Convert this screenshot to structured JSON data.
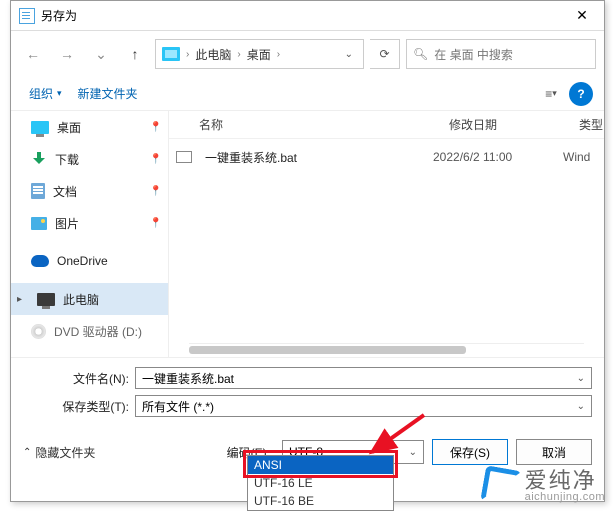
{
  "title": "另存为",
  "nav": {
    "back": "←",
    "fwd": "→",
    "up": "↑",
    "refresh": "⟳"
  },
  "address": {
    "crumb1": "此电脑",
    "crumb2": "桌面",
    "sep": "›",
    "dd": "⌄"
  },
  "search": {
    "placeholder": "在 桌面 中搜索",
    "icon": "🔍"
  },
  "toolbar": {
    "organize": "组织",
    "newfolder": "新建文件夹",
    "view": "≡",
    "help": "?"
  },
  "sidebar": {
    "items": [
      {
        "label": "桌面"
      },
      {
        "label": "下载"
      },
      {
        "label": "文档"
      },
      {
        "label": "图片"
      },
      {
        "label": "OneDrive"
      },
      {
        "label": "此电脑"
      },
      {
        "label": "DVD 驱动器 (D:)"
      }
    ],
    "pin": "📌"
  },
  "filelist": {
    "headers": {
      "name": "名称",
      "date": "修改日期",
      "type": "类型"
    },
    "rows": [
      {
        "name": "一键重装系统.bat",
        "date": "2022/6/2 11:00",
        "type": "Wind"
      }
    ]
  },
  "form": {
    "filename_label": "文件名(N):",
    "filename_value": "一键重装系统.bat",
    "type_label": "保存类型(T):",
    "type_value": "所有文件 (*.*)"
  },
  "hide_link": "隐藏文件夹",
  "encoding": {
    "label": "编码(E):",
    "value": "UTF-8",
    "options": [
      "ANSI",
      "UTF-16 LE",
      "UTF-16 BE"
    ]
  },
  "buttons": {
    "save": "保存(S)",
    "cancel": "取消"
  },
  "watermark": {
    "cn": "爱纯净",
    "en": "aichunjing.com"
  }
}
